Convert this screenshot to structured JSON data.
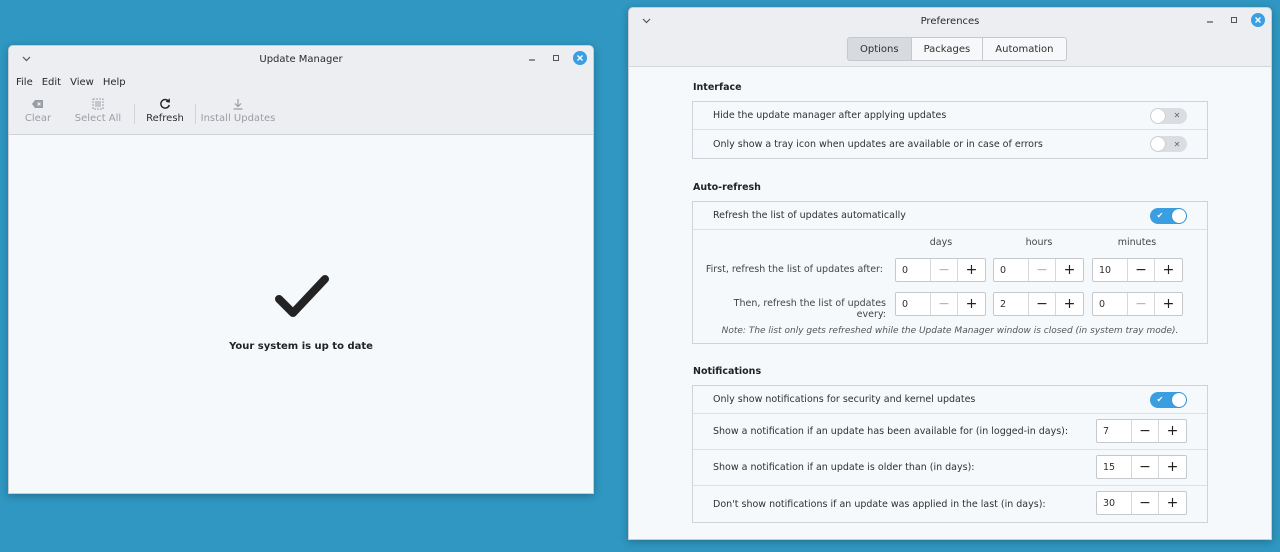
{
  "update_manager": {
    "title": "Update Manager",
    "menu": [
      "File",
      "Edit",
      "View",
      "Help"
    ],
    "toolbar": {
      "clear": "Clear",
      "select_all": "Select All",
      "refresh": "Refresh",
      "install_updates": "Install Updates"
    },
    "status_message": "Your system is up to date"
  },
  "preferences": {
    "title": "Preferences",
    "tabs": [
      "Options",
      "Packages",
      "Automation"
    ],
    "active_tab": "Options",
    "interface": {
      "title": "Interface",
      "rows": [
        {
          "label": "Hide the update manager after applying updates",
          "enabled": false
        },
        {
          "label": "Only show a tray icon when updates are available or in case of errors",
          "enabled": false
        }
      ]
    },
    "auto_refresh": {
      "title": "Auto-refresh",
      "toggle_label": "Refresh the list of updates automatically",
      "enabled": true,
      "columns": [
        "days",
        "hours",
        "minutes"
      ],
      "first_label": "First, refresh the list of updates after:",
      "first_values": [
        "0",
        "0",
        "10"
      ],
      "then_label": "Then, refresh the list of updates every:",
      "then_values": [
        "0",
        "2",
        "0"
      ],
      "note": "Note: The list only gets refreshed while the Update Manager window is closed (in system tray mode)."
    },
    "notifications": {
      "title": "Notifications",
      "security_label": "Only show notifications for security and kernel updates",
      "security_enabled": true,
      "rows": [
        {
          "label": "Show a notification if an update has been available for (in logged-in days):",
          "value": "7"
        },
        {
          "label": "Show a notification if an update is older than (in days):",
          "value": "15"
        },
        {
          "label": "Don't show notifications if an update was applied in the last (in days):",
          "value": "30"
        }
      ]
    }
  },
  "colors": {
    "desktop": "#2f97c1",
    "accent": "#3a9ee0"
  }
}
